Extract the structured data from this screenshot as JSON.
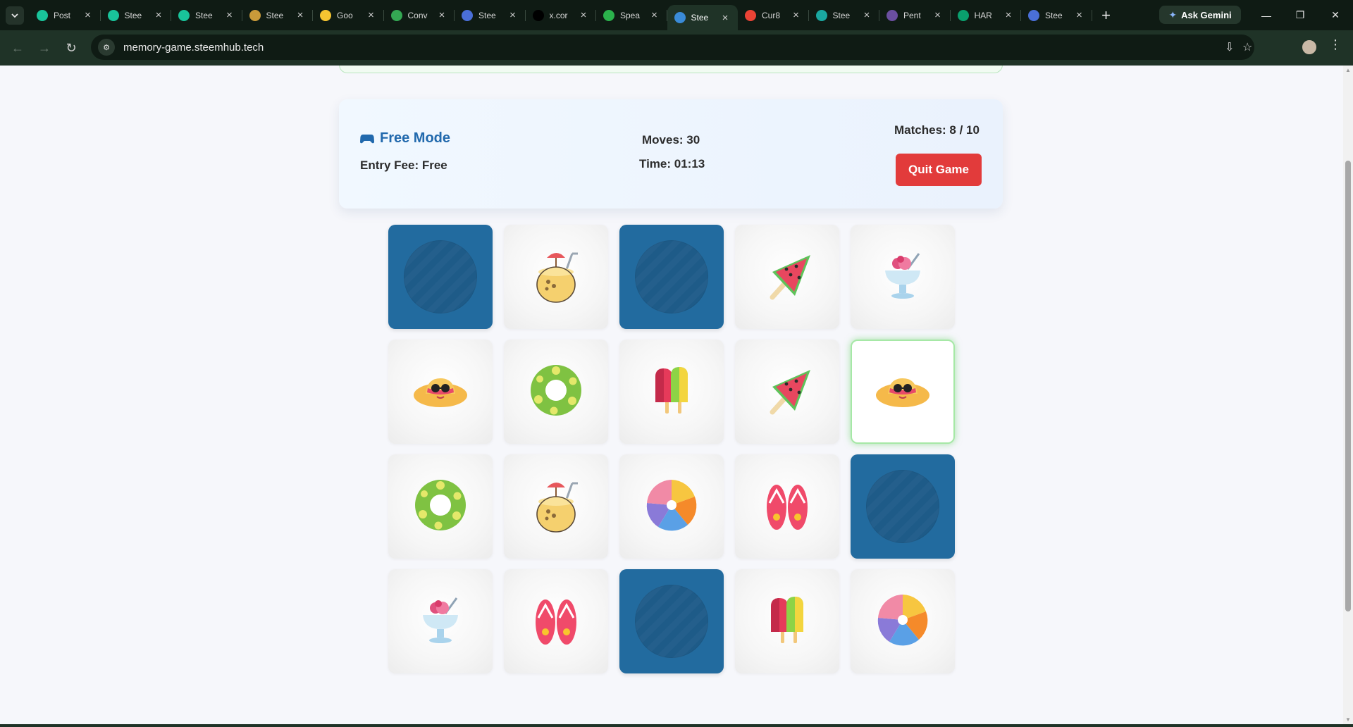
{
  "browser": {
    "tabs": [
      {
        "title": "Post",
        "favicon": "steem-green-icon",
        "color": "#19c39a"
      },
      {
        "title": "Stee",
        "favicon": "steem-green-icon",
        "color": "#19c39a"
      },
      {
        "title": "Stee",
        "favicon": "steem-green-icon",
        "color": "#19c39a"
      },
      {
        "title": "Stee",
        "favicon": "avatar-icon",
        "color": "#c99a3a"
      },
      {
        "title": "Goo",
        "favicon": "lightbulb-icon",
        "color": "#f5c431"
      },
      {
        "title": "Conv",
        "favicon": "drive-icon",
        "color": "#34a853"
      },
      {
        "title": "Stee",
        "favicon": "globe-icon",
        "color": "#4a6fd8"
      },
      {
        "title": "x.cor",
        "favicon": "x-icon",
        "color": "#000000"
      },
      {
        "title": "Spea",
        "favicon": "play-icon",
        "color": "#2bb24c"
      },
      {
        "title": "Stee",
        "favicon": "globe-icon",
        "color": "#3a8bd8",
        "active": true
      },
      {
        "title": "Cur8",
        "favicon": "google-icon",
        "color": "#ea4335"
      },
      {
        "title": "Stee",
        "favicon": "steem-teal-icon",
        "color": "#1aa7a0"
      },
      {
        "title": "Pent",
        "favicon": "avatar-icon",
        "color": "#6b4fa0"
      },
      {
        "title": "HAR",
        "favicon": "har-icon",
        "color": "#0aa06e"
      },
      {
        "title": "Stee",
        "favicon": "globe-icon",
        "color": "#4a6fd8"
      }
    ],
    "gemini_label": "Ask Gemini",
    "url": "memory-game.steemhub.tech"
  },
  "game": {
    "mode_label": "Free Mode",
    "entry_fee": "Entry Fee: Free",
    "moves": "Moves: 30",
    "time": "Time: 01:13",
    "matches": "Matches: 8 / 10",
    "quit_label": "Quit Game",
    "cards": [
      {
        "state": "hidden"
      },
      {
        "state": "face",
        "icon": "coconut-drink-icon"
      },
      {
        "state": "hidden"
      },
      {
        "state": "face",
        "icon": "watermelon-icon"
      },
      {
        "state": "face",
        "icon": "ice-cream-cup-icon"
      },
      {
        "state": "face",
        "icon": "sun-hat-icon"
      },
      {
        "state": "face",
        "icon": "swim-ring-icon"
      },
      {
        "state": "face",
        "icon": "popsicle-icon"
      },
      {
        "state": "face",
        "icon": "watermelon-icon"
      },
      {
        "state": "selected",
        "icon": "sun-hat-icon"
      },
      {
        "state": "face",
        "icon": "swim-ring-icon"
      },
      {
        "state": "face",
        "icon": "coconut-drink-icon"
      },
      {
        "state": "face",
        "icon": "beach-ball-icon"
      },
      {
        "state": "face",
        "icon": "flip-flops-icon"
      },
      {
        "state": "hidden"
      },
      {
        "state": "face",
        "icon": "ice-cream-cup-icon"
      },
      {
        "state": "face",
        "icon": "flip-flops-icon"
      },
      {
        "state": "hidden"
      },
      {
        "state": "face",
        "icon": "popsicle-icon"
      },
      {
        "state": "face",
        "icon": "beach-ball-icon"
      }
    ]
  }
}
